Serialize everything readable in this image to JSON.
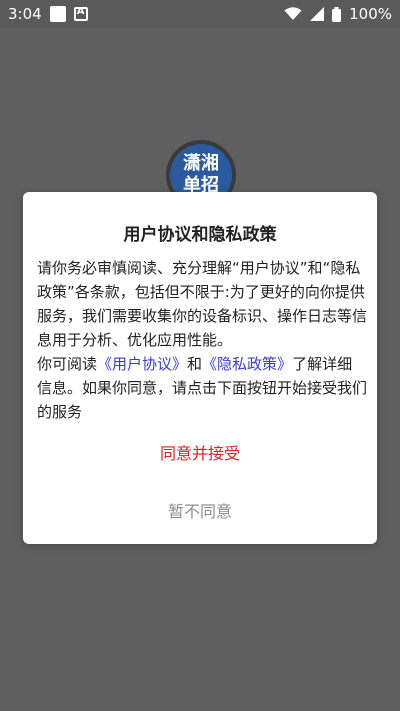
{
  "status_bar": {
    "time": "3:04",
    "battery": "100%"
  },
  "background": {
    "logo_text_line1": "潇湘",
    "logo_text_line2": "单招"
  },
  "dialog": {
    "title": "用户协议和隐私政策",
    "paragraph1": "请你务必审慎阅读、充分理解“用户协议”和“隐私政策”各条款，包括但不限于:为了更好的向你提供服务，我们需要收集你的设备标识、操作日志等信息用于分析、优化应用性能。",
    "p2_prefix": "你可阅读",
    "user_agreement_link": "《用户协议》",
    "and_text": "和",
    "privacy_policy_link": "《隐私政策》",
    "p2_suffix": "了解详细信息。如果你同意，请点击下面按钮开始接受我们的服务",
    "accept_label": "同意并接受",
    "reject_label": "暂不同意"
  }
}
